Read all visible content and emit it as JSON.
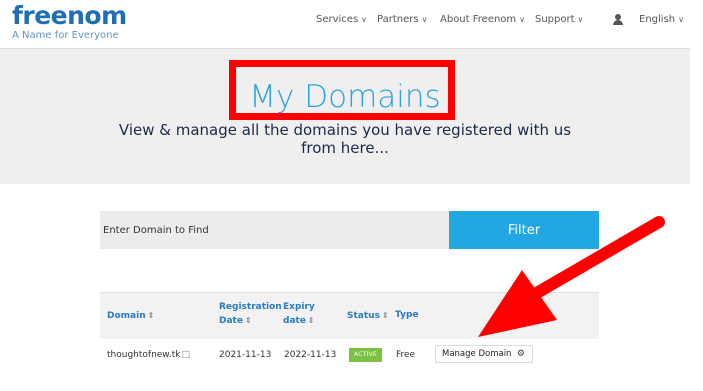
{
  "header": {
    "logo": "freenom",
    "tagline": "A Name for Everyone",
    "nav": {
      "services": "Services",
      "partners": "Partners",
      "about": "About Freenom",
      "support": "Support",
      "language": "English"
    }
  },
  "hero": {
    "title": "My Domains",
    "subtitle": "View & manage all the domains you have registered with us from here..."
  },
  "search": {
    "placeholder": "Enter Domain to Find",
    "filter_label": "Filter"
  },
  "table": {
    "headers": {
      "domain": "Domain",
      "registration_line1": "Registration",
      "registration_line2": "Date",
      "expiry_line1": "Expiry",
      "expiry_line2": "date",
      "status": "Status",
      "type": "Type"
    },
    "rows": [
      {
        "domain": "thoughtofnew.tk",
        "registration": "2021-11-13",
        "expiry": "2022-11-13",
        "status": "ACTIVE",
        "type": "Free",
        "action": "Manage Domain"
      }
    ]
  },
  "colors": {
    "brand": "#1e6fb5",
    "accent": "#22a7e3",
    "annotation": "#ff0000",
    "active": "#7bc142"
  }
}
